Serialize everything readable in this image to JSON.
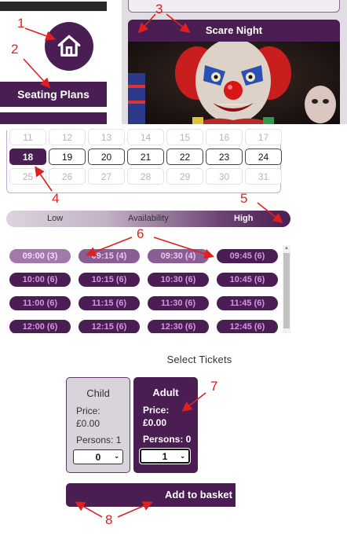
{
  "seating_panel": {
    "button_label": "Seating Plans",
    "home_icon": "home-icon"
  },
  "event": {
    "title": "Scare Night",
    "image_desc": "clown-image"
  },
  "calendar": {
    "rows": [
      [
        {
          "day": "11",
          "state": "disabled"
        },
        {
          "day": "12",
          "state": "disabled"
        },
        {
          "day": "13",
          "state": "disabled"
        },
        {
          "day": "14",
          "state": "disabled"
        },
        {
          "day": "15",
          "state": "disabled"
        },
        {
          "day": "16",
          "state": "disabled"
        },
        {
          "day": "17",
          "state": "disabled"
        }
      ],
      [
        {
          "day": "18",
          "state": "selected"
        },
        {
          "day": "19",
          "state": "available"
        },
        {
          "day": "20",
          "state": "available"
        },
        {
          "day": "21",
          "state": "available"
        },
        {
          "day": "22",
          "state": "available"
        },
        {
          "day": "23",
          "state": "available"
        },
        {
          "day": "24",
          "state": "available"
        }
      ],
      [
        {
          "day": "25",
          "state": "disabled"
        },
        {
          "day": "26",
          "state": "disabled"
        },
        {
          "day": "27",
          "state": "disabled"
        },
        {
          "day": "28",
          "state": "disabled"
        },
        {
          "day": "29",
          "state": "disabled"
        },
        {
          "day": "30",
          "state": "disabled"
        },
        {
          "day": "31",
          "state": "disabled"
        }
      ]
    ]
  },
  "availability": {
    "low": "Low",
    "label": "Availability",
    "high": "High"
  },
  "time_slots": [
    {
      "label": "09:00 (3)",
      "level": "low"
    },
    {
      "label": "09:15 (4)",
      "level": "mid"
    },
    {
      "label": "09:30 (4)",
      "level": "mid"
    },
    {
      "label": "09:45 (6)",
      "level": "high"
    },
    {
      "label": "10:00 (6)",
      "level": "high"
    },
    {
      "label": "10:15 (6)",
      "level": "high"
    },
    {
      "label": "10:30 (6)",
      "level": "high"
    },
    {
      "label": "10:45 (6)",
      "level": "high"
    },
    {
      "label": "11:00 (6)",
      "level": "high"
    },
    {
      "label": "11:15 (6)",
      "level": "high"
    },
    {
      "label": "11:30 (6)",
      "level": "high"
    },
    {
      "label": "11:45 (6)",
      "level": "high"
    },
    {
      "label": "12:00 (6)",
      "level": "high"
    },
    {
      "label": "12:15 (6)",
      "level": "high"
    },
    {
      "label": "12:30 (6)",
      "level": "high"
    },
    {
      "label": "12:45 (6)",
      "level": "high"
    }
  ],
  "tickets": {
    "title": "Select Tickets",
    "child": {
      "name": "Child",
      "price_label": "Price:",
      "price": "£0.00",
      "persons": "Persons: 1",
      "qty": "0"
    },
    "adult": {
      "name": "Adult",
      "price_label": "Price:",
      "price": "£0.00",
      "persons": "Persons: 0",
      "qty": "1"
    }
  },
  "add_to_basket": "Add to basket",
  "annotations": [
    "1",
    "2",
    "3",
    "4",
    "5",
    "6",
    "7",
    "8"
  ],
  "colors": {
    "brand": "#4a1e52",
    "annotation": "#e02020"
  }
}
